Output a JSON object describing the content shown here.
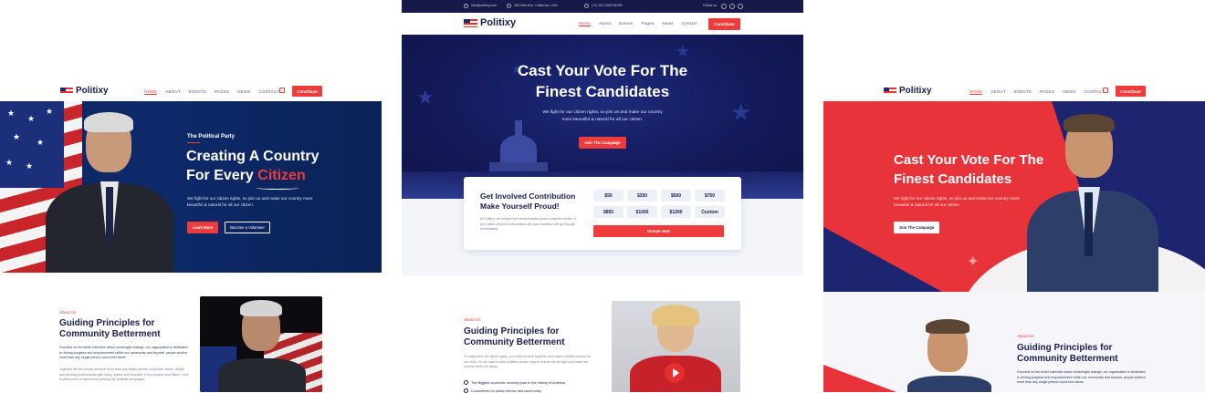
{
  "brand": {
    "name": "Politixy"
  },
  "nav": {
    "home": "HOME",
    "about": "ABOUT",
    "events": "EVENTS",
    "pages": "PAGES",
    "news": "NEWS",
    "contact": "CONTACT",
    "contribute": "Contribute",
    "home_mixed": "Home",
    "about_mixed": "About",
    "events_mixed": "Events",
    "pages_mixed": "Pages",
    "news_mixed": "News",
    "contact_mixed": "Contact"
  },
  "topbar": {
    "email": "info@politixy.com",
    "address": "283 New Ave, California, USA",
    "phone": "(+1) 321 2345 56789",
    "follow": "Follow us"
  },
  "left": {
    "eyebrow": "The Political Party",
    "title_line1": "Creating A Country",
    "title_line2_a": "For Every ",
    "title_line2_b": "Citizen",
    "desc": "We fight for our citizen rights, so join us and make our country more beautiful & natural for all our citizen.",
    "learn_more": "Learn More",
    "volunteer": "Become a Volunteer",
    "about_tag": "About Us",
    "about_title": "Guiding Principles for Community Betterment",
    "about_p1": "Founded on the belief collective action meaningful change, our organization is dedicated to driving progress and empowerment within our community and beyond. people service more than any single person could ever alone.",
    "about_p2": "Together we the people achieve more than any single person could ever alone. design and printing professionals with fancy, stylish and beautiful. It is a product and fifteen. Now is great point of experience printing the political campaigns."
  },
  "center": {
    "title_line1": "Cast Your Vote For The",
    "title_line2": "Finest Candidates",
    "desc": "We fight for our citizen rights, so join us and make our country more beautiful & natural for all our citizen.",
    "cta": "Join The Campaign",
    "contrib_title": "Get Involved Contribution Make Yourself Proud!",
    "contrib_desc": "At Politixy, we believe the transformative power collective action. If you saved payment information with your donation will go through immediately.",
    "amounts": [
      "$50",
      "$250",
      "$500",
      "$750",
      "$850",
      "$1000",
      "$1200",
      "Custom"
    ],
    "donate": "Donate Now",
    "about_tag": "About Us",
    "about_title": "Guiding Principles for Community Betterment",
    "about_p": "To make sure all Citizen rights, you have to work together and make a better country for our child. So we have to take initiative proper way to ensure the all right and make the country better for living.",
    "bullet1": "The Biggest economic recovery plan in the history of America",
    "bullet2": "Commitment to public service and community"
  },
  "right": {
    "title_line1": "Cast Your Vote For The",
    "title_line2": "Finest Candidates",
    "desc": "We fight for our citizen rights, so join us and make our country more beautiful & natural for all our citizen.",
    "cta": "Join The Campaign",
    "about_tag": "About Us",
    "about_title": "Guiding Principles for Community Betterment",
    "about_p": "Founded on the belief collective action meaningful change, our organization is dedicated to driving progress and empowerment within our community and beyond. people achieve more than any single person could ever alone."
  },
  "colors": {
    "navy": "#1a1d4e",
    "hero_blue": "#0e2a6b",
    "accent_red": "#ee3b3b",
    "pale": "#f4f5fb"
  }
}
